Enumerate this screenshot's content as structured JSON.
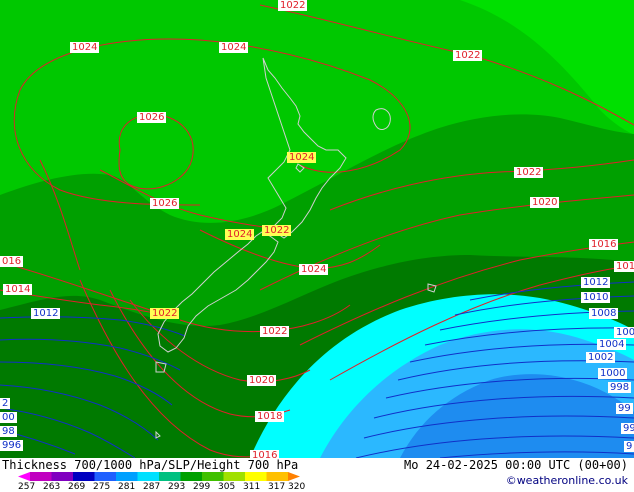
{
  "footer": {
    "title": "Thickness 700/1000 hPa/SLP/Height 700 hPa",
    "datetime": "Mo 24-02-2025 00:00 UTC (00+00)",
    "credit": "©weatheronline.co.uk"
  },
  "legend": {
    "ticks": [
      "257",
      "263",
      "269",
      "275",
      "281",
      "287",
      "293",
      "299",
      "305",
      "311",
      "317",
      "320"
    ],
    "colors": [
      "#ff00ff",
      "#c000c0",
      "#8000c0",
      "#0000c0",
      "#2060ff",
      "#00a0ff",
      "#00e0ff",
      "#00c080",
      "#00a000",
      "#40c000",
      "#a0e000",
      "#ffff00",
      "#ffc000",
      "#ff8000"
    ]
  },
  "map": {
    "colors": {
      "green_dark": "#007a00",
      "green_mid": "#00a000",
      "green_light": "#00c800",
      "green_bright": "#00e000",
      "cyan": "#00ffff",
      "sky": "#2bb8ff",
      "blue": "#1e8cf0",
      "coast": "#d0d0d0",
      "isobar_red": "#e0202a",
      "isobar_blue": "#1030c8"
    },
    "pressure_labels": [
      {
        "text": "1022",
        "color": "red"
      },
      {
        "text": "1024",
        "color": "red"
      },
      {
        "text": "1024",
        "color": "red"
      },
      {
        "text": "1022",
        "color": "red"
      },
      {
        "text": "1026",
        "color": "red"
      },
      {
        "text": "1024",
        "color": "red"
      },
      {
        "text": "1026",
        "color": "red"
      },
      {
        "text": "1022",
        "color": "red"
      },
      {
        "text": "1020",
        "color": "red"
      },
      {
        "text": "1024",
        "color": "red"
      },
      {
        "text": "1022",
        "color": "red"
      },
      {
        "text": "016",
        "color": "red"
      },
      {
        "text": "1014",
        "color": "red"
      },
      {
        "text": "1016",
        "color": "red"
      },
      {
        "text": "101",
        "color": "red"
      },
      {
        "text": "1024",
        "color": "red"
      },
      {
        "text": "1012",
        "color": "blue"
      },
      {
        "text": "1022",
        "color": "red"
      },
      {
        "text": "1012",
        "color": "blue"
      },
      {
        "text": "1010",
        "color": "blue"
      },
      {
        "text": "1008",
        "color": "blue"
      },
      {
        "text": "1022",
        "color": "red"
      },
      {
        "text": "100",
        "color": "blue"
      },
      {
        "text": "1004",
        "color": "blue"
      },
      {
        "text": "1002",
        "color": "blue"
      },
      {
        "text": "1000",
        "color": "blue"
      },
      {
        "text": "998",
        "color": "blue"
      },
      {
        "text": "1020",
        "color": "red"
      },
      {
        "text": "99",
        "color": "blue"
      },
      {
        "text": "1018",
        "color": "red"
      },
      {
        "text": "99",
        "color": "blue"
      },
      {
        "text": "9",
        "color": "blue"
      },
      {
        "text": "1016",
        "color": "red"
      },
      {
        "text": "2",
        "color": "blue"
      },
      {
        "text": "00",
        "color": "blue"
      },
      {
        "text": "98",
        "color": "blue"
      },
      {
        "text": "996",
        "color": "blue"
      }
    ]
  }
}
